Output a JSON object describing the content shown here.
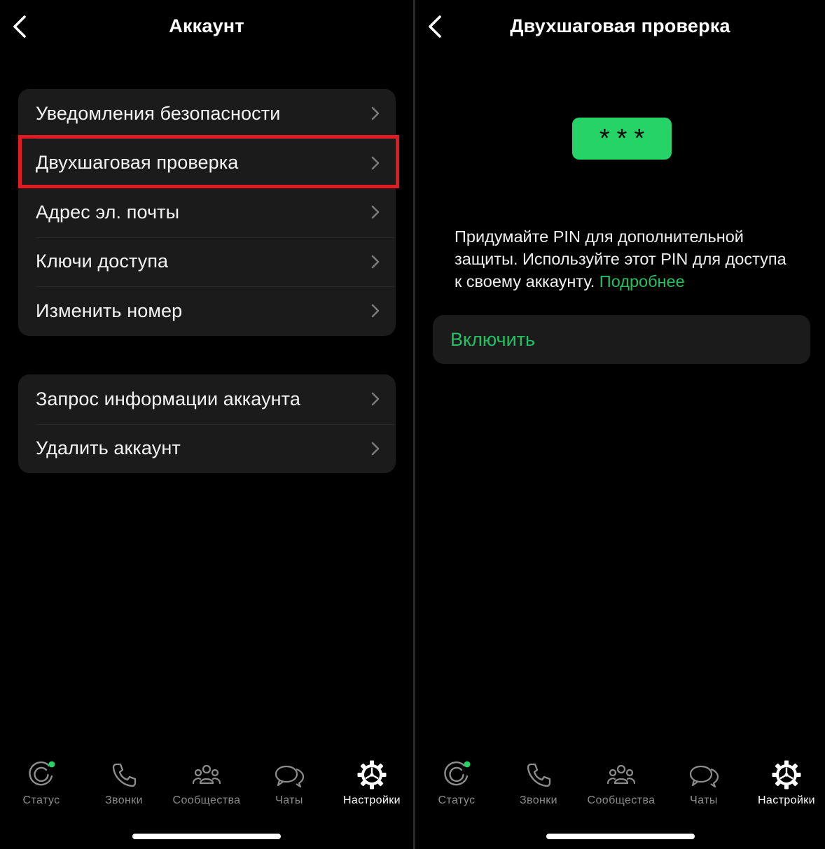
{
  "left_screen": {
    "title": "Аккаунт",
    "group1": [
      {
        "label": "Уведомления безопасности"
      },
      {
        "label": "Двухшаговая проверка"
      },
      {
        "label": "Адрес эл. почты"
      },
      {
        "label": "Ключи доступа"
      },
      {
        "label": "Изменить номер"
      }
    ],
    "group2": [
      {
        "label": "Запрос информации аккаунта"
      },
      {
        "label": "Удалить аккаунт"
      }
    ]
  },
  "right_screen": {
    "title": "Двухшаговая проверка",
    "pin_badge": "***",
    "description": "Придумайте PIN для дополнительной защиты. Используйте этот PIN для доступа к своему аккаунту.",
    "learn_more": "Подробнее",
    "enable_label": "Включить"
  },
  "tabbar": {
    "tabs": [
      {
        "label": "Статус",
        "icon": "status-icon"
      },
      {
        "label": "Звонки",
        "icon": "phone-icon"
      },
      {
        "label": "Сообщества",
        "icon": "communities-icon"
      },
      {
        "label": "Чаты",
        "icon": "chats-icon"
      },
      {
        "label": "Настройки",
        "icon": "gear-icon",
        "active": true
      }
    ]
  },
  "colors": {
    "accent_green": "#21c063",
    "pin_badge_green": "#25d366",
    "highlight_red": "#e11b22",
    "status_dot_green": "#25d366"
  }
}
